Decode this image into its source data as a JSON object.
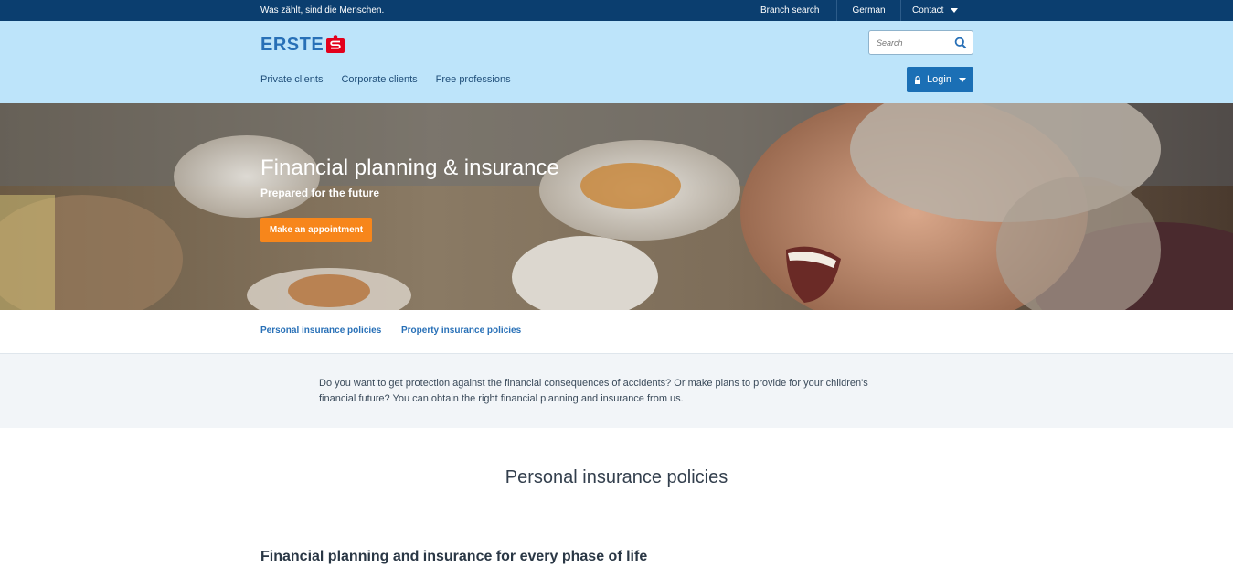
{
  "topbar": {
    "tagline": "Was zählt, sind die Menschen.",
    "branch_search": "Branch search",
    "language": "German",
    "contact": "Contact"
  },
  "header": {
    "logo_text": "ERSTE",
    "search_placeholder": "Search",
    "nav": [
      "Private clients",
      "Corporate clients",
      "Free professions"
    ],
    "login_label": "Login"
  },
  "hero": {
    "title": "Financial planning & insurance",
    "subtitle": "Prepared for the future",
    "cta": "Make an appointment"
  },
  "anchors": [
    "Personal insurance policies",
    "Property insurance policies"
  ],
  "intro": {
    "text": "Do you want to get protection against the financial consequences of accidents? Or make plans to provide for your children's financial future? You can obtain the right financial planning and insurance from us."
  },
  "section": {
    "title": "Personal insurance policies",
    "subtitle": "Financial planning and insurance for every phase of life"
  },
  "colors": {
    "topbar": "#0b3e6f",
    "header": "#bde4fa",
    "brand_blue": "#2870b7",
    "brand_red": "#e3001b",
    "cta_orange": "#f7861b",
    "login_blue": "#1b6fb5"
  },
  "icons": [
    "erste-s-logo-icon",
    "search-icon",
    "lock-icon",
    "chevron-down-icon"
  ]
}
